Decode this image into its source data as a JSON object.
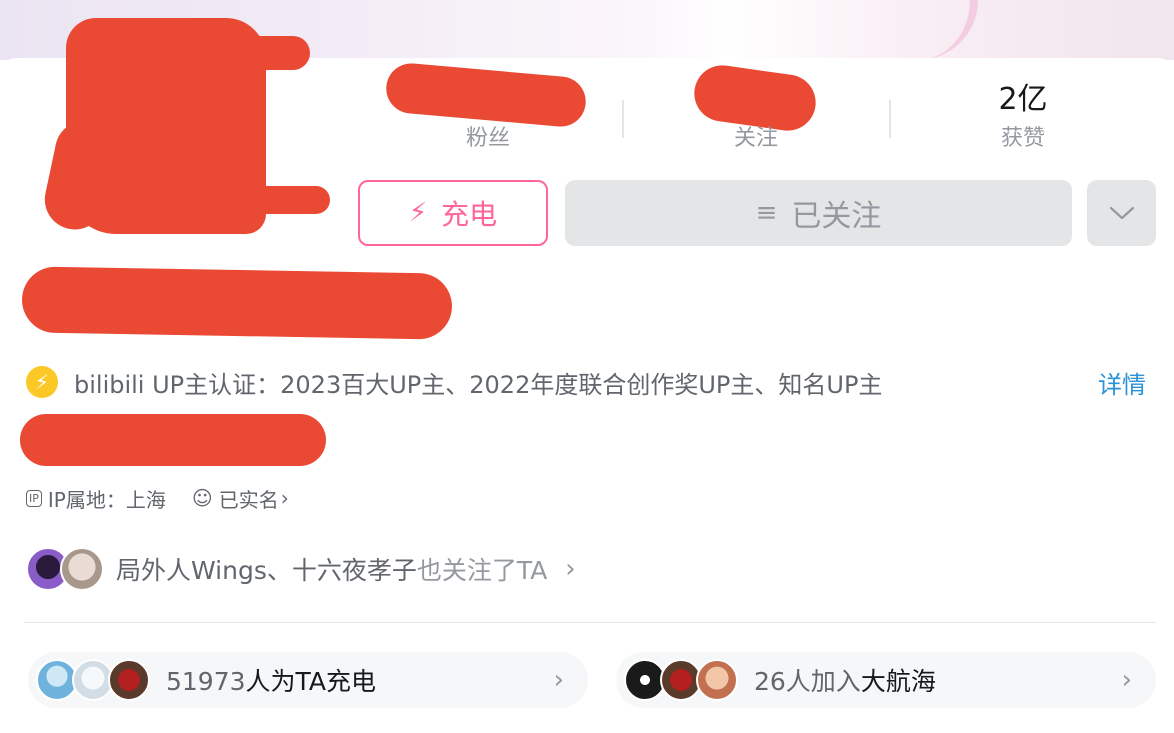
{
  "stats": [
    {
      "value": "",
      "label": "粉丝"
    },
    {
      "value": "",
      "label": "关注"
    },
    {
      "value": "2亿",
      "label": "获赞"
    }
  ],
  "actions": {
    "charge_label": "充电",
    "follow_label": "已关注"
  },
  "verification": {
    "text": "bilibili UP主认证：2023百大UP主、2022年度联合创作奖UP主、知名UP主",
    "detail_link": "详情"
  },
  "ip": {
    "badge": "IP",
    "location": "IP属地：上海",
    "realname": "已实名"
  },
  "mutual_follow": {
    "names": "局外人Wings、十六夜孝子",
    "suffix": "也关注了TA"
  },
  "charge_summary": {
    "count": "51973",
    "text": "人为TA充电"
  },
  "fleet_summary": {
    "count_text": "26人加入",
    "highlight": "大航海"
  },
  "colors": {
    "accent_pink": "#ff6699",
    "link_blue": "#2a92d6",
    "verify_yellow": "#fcc826",
    "redaction": "#ea4a34"
  }
}
